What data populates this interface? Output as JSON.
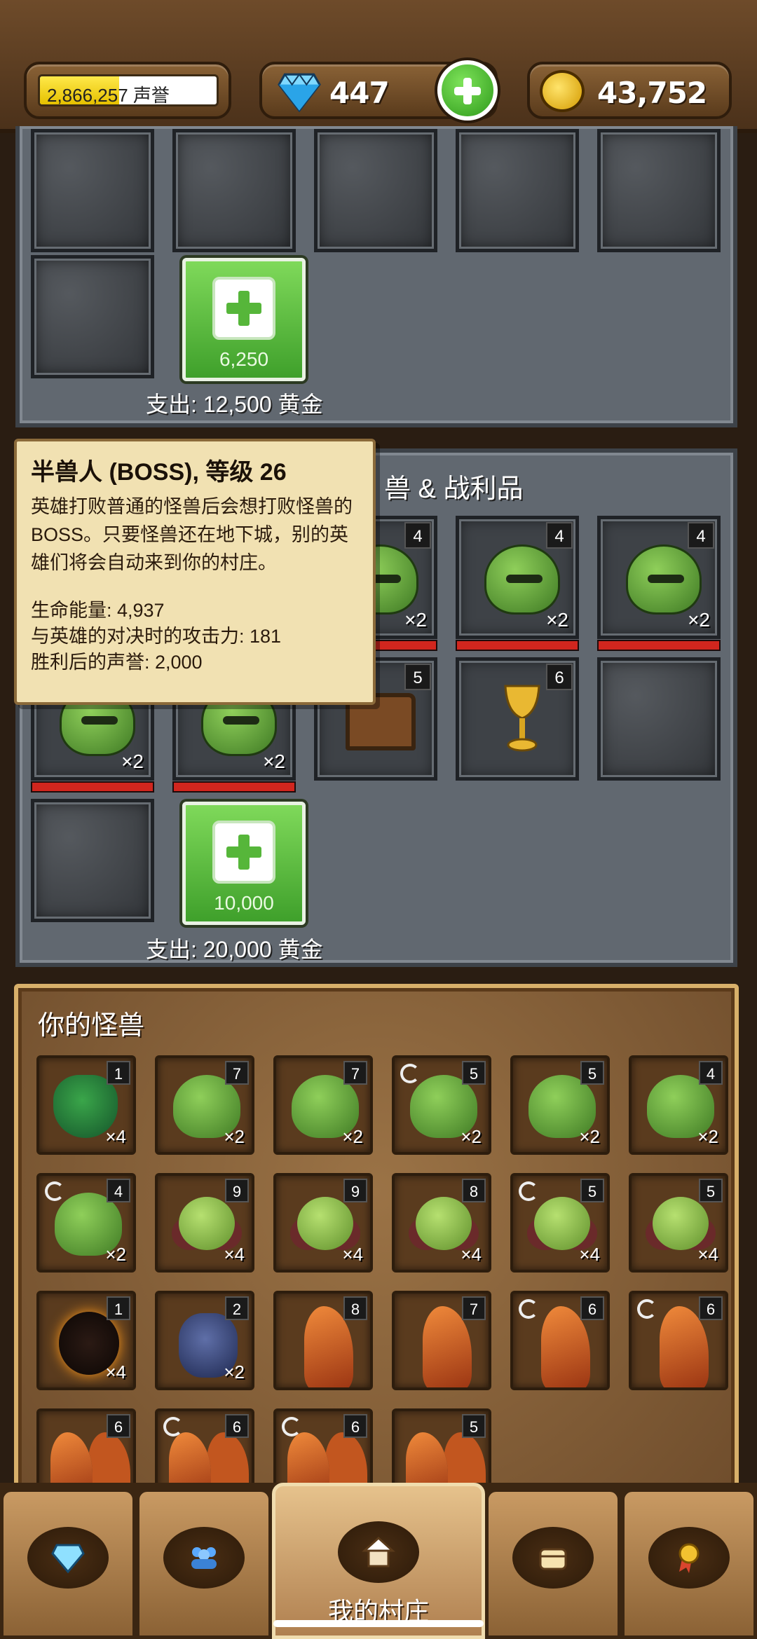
{
  "topbar": {
    "reputation_text": "2,866,257 声誉",
    "reputation_progress": 0.45,
    "gems": "447",
    "gold": "43,752"
  },
  "panel1": {
    "add_price": "6,250",
    "expense": "支出: 12,500 黄金"
  },
  "panel2": {
    "title_partial": "兽 & 战利品",
    "add_price": "10,000",
    "expense": "支出: 20,000 黄金",
    "slots_row1": [
      {
        "level": "4",
        "count": "×2"
      },
      {
        "level": "4",
        "count": "×2"
      },
      {
        "level": "4",
        "count": "×2"
      }
    ],
    "slots_row2": [
      {
        "level": "",
        "count": "×2"
      },
      {
        "level": "",
        "count": "×2"
      },
      {
        "level": "5",
        "count": ""
      },
      {
        "level": "6",
        "count": ""
      }
    ]
  },
  "tooltip": {
    "title": "半兽人 (BOSS), 等级 26",
    "description": "英雄打败普通的怪兽后会想打败怪兽的BOSS。只要怪兽还在地下城，别的英雄们将会自动来到你的村庄。",
    "hp": "生命能量: 4,937",
    "attack": "与英雄的对决时的攻击力: 181",
    "reputation": "胜利后的声誉: 2,000"
  },
  "monsters": {
    "title": "你的怪兽",
    "cards": [
      {
        "type": "goblin",
        "level": "1",
        "count": "×4",
        "refresh": false
      },
      {
        "type": "orc",
        "level": "7",
        "count": "×2",
        "refresh": false
      },
      {
        "type": "orc",
        "level": "7",
        "count": "×2",
        "refresh": false
      },
      {
        "type": "orc",
        "level": "5",
        "count": "×2",
        "refresh": true
      },
      {
        "type": "orc",
        "level": "5",
        "count": "×2",
        "refresh": false
      },
      {
        "type": "orc",
        "level": "4",
        "count": "×2",
        "refresh": false
      },
      {
        "type": "orc",
        "level": "4",
        "count": "×2",
        "refresh": true
      },
      {
        "type": "imp",
        "level": "9",
        "count": "×4",
        "refresh": false
      },
      {
        "type": "imp",
        "level": "9",
        "count": "×4",
        "refresh": false
      },
      {
        "type": "imp",
        "level": "8",
        "count": "×4",
        "refresh": false
      },
      {
        "type": "imp",
        "level": "5",
        "count": "×4",
        "refresh": true
      },
      {
        "type": "imp",
        "level": "5",
        "count": "×4",
        "refresh": false
      },
      {
        "type": "fire",
        "level": "1",
        "count": "×4",
        "refresh": false
      },
      {
        "type": "minotaur",
        "level": "2",
        "count": "×2",
        "refresh": false
      },
      {
        "type": "dragon",
        "level": "8",
        "count": "",
        "refresh": false
      },
      {
        "type": "dragon",
        "level": "7",
        "count": "",
        "refresh": false
      },
      {
        "type": "dragon",
        "level": "6",
        "count": "",
        "refresh": true
      },
      {
        "type": "dragon",
        "level": "6",
        "count": "",
        "refresh": true
      },
      {
        "type": "dragon2",
        "level": "6",
        "count": "",
        "refresh": false
      },
      {
        "type": "dragon2",
        "level": "6",
        "count": "",
        "refresh": true
      },
      {
        "type": "dragon2",
        "level": "6",
        "count": "",
        "refresh": true
      },
      {
        "type": "dragon2",
        "level": "5",
        "count": "",
        "refresh": false
      }
    ]
  },
  "nav": {
    "items": [
      {
        "icon": "diamond-icon",
        "label": ""
      },
      {
        "icon": "people-icon",
        "label": ""
      },
      {
        "icon": "house-icon",
        "label": "我的村庄"
      },
      {
        "icon": "chest-icon",
        "label": ""
      },
      {
        "icon": "medal-icon",
        "label": ""
      }
    ]
  }
}
